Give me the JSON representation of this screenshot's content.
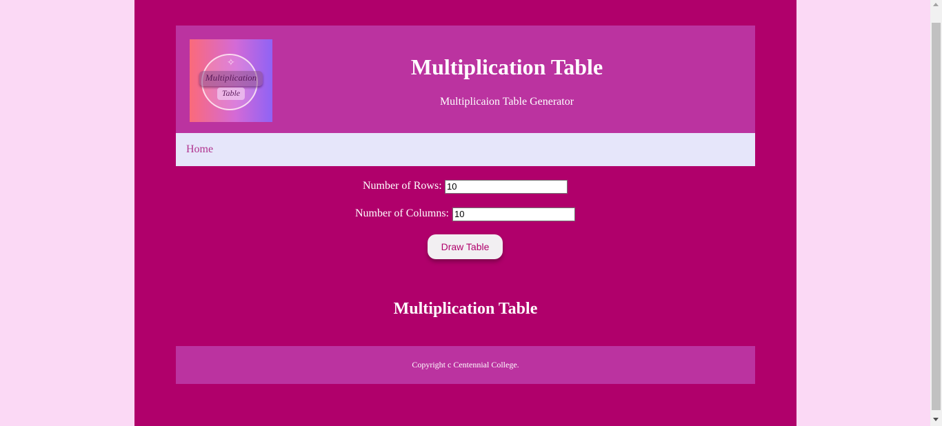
{
  "header": {
    "title": "Multiplication Table",
    "subtitle": "Multiplicaion Table Generator",
    "logo": {
      "line1": "Multiplication",
      "line2": "Table",
      "icon": "sparkle-icon"
    }
  },
  "nav": {
    "items": [
      {
        "label": "Home"
      }
    ]
  },
  "form": {
    "rows_label": "Number of Rows:",
    "rows_value": "10",
    "columns_label": "Number of Columns:",
    "columns_value": "10",
    "submit_label": "Draw Table"
  },
  "results": {
    "title": "Multiplication Table"
  },
  "footer": {
    "text": "Copyright c Centennial College."
  },
  "colors": {
    "page_background": "#fbd9f5",
    "content_background": "#b0006b",
    "header_background": "#bb33a0",
    "nav_background": "#e6e6fa",
    "nav_link": "#b0338f"
  }
}
